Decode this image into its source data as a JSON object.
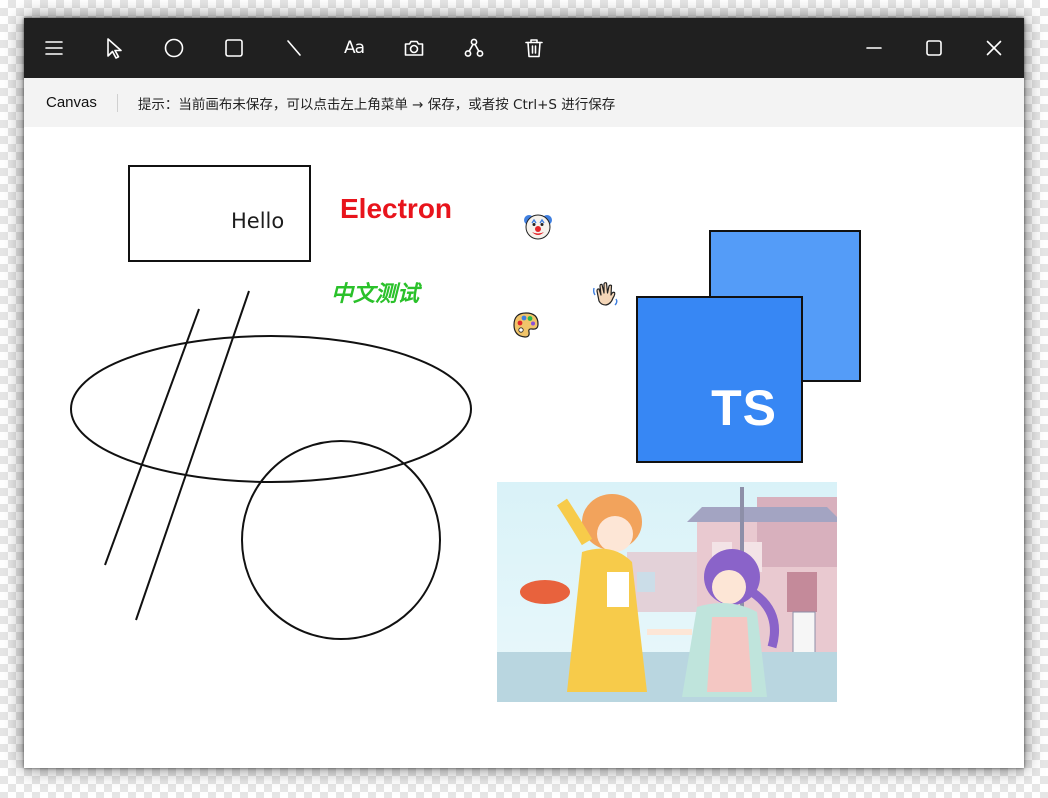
{
  "toolbar": {
    "text_tool_label": "Aa"
  },
  "statusbar": {
    "title": "Canvas",
    "hint": "提示：当前画布未保存，可以点击左上角菜单 → 保存，或者按 Ctrl+S 进行保存"
  },
  "canvas": {
    "hello_text": "Hello",
    "electron_text": "Electron",
    "chinese_text": "中文测试",
    "ts_label": "TS"
  },
  "colors": {
    "titlebar": "#202020",
    "statusbar": "#f3f3f3",
    "electron_red": "#e8141c",
    "chinese_green": "#2ac12a",
    "ts_back_blue": "#549cf8",
    "ts_front_blue": "#3787f4"
  },
  "icons": {
    "toolbar": [
      "menu-icon",
      "pointer-icon",
      "circle-icon",
      "rectangle-icon",
      "line-icon",
      "text-icon",
      "camera-icon",
      "share-icon",
      "trash-icon"
    ],
    "window": [
      "minimize-icon",
      "maximize-icon",
      "close-icon"
    ],
    "stickers": [
      "clown-emoji",
      "waving-hand-emoji",
      "palette-emoji"
    ]
  }
}
